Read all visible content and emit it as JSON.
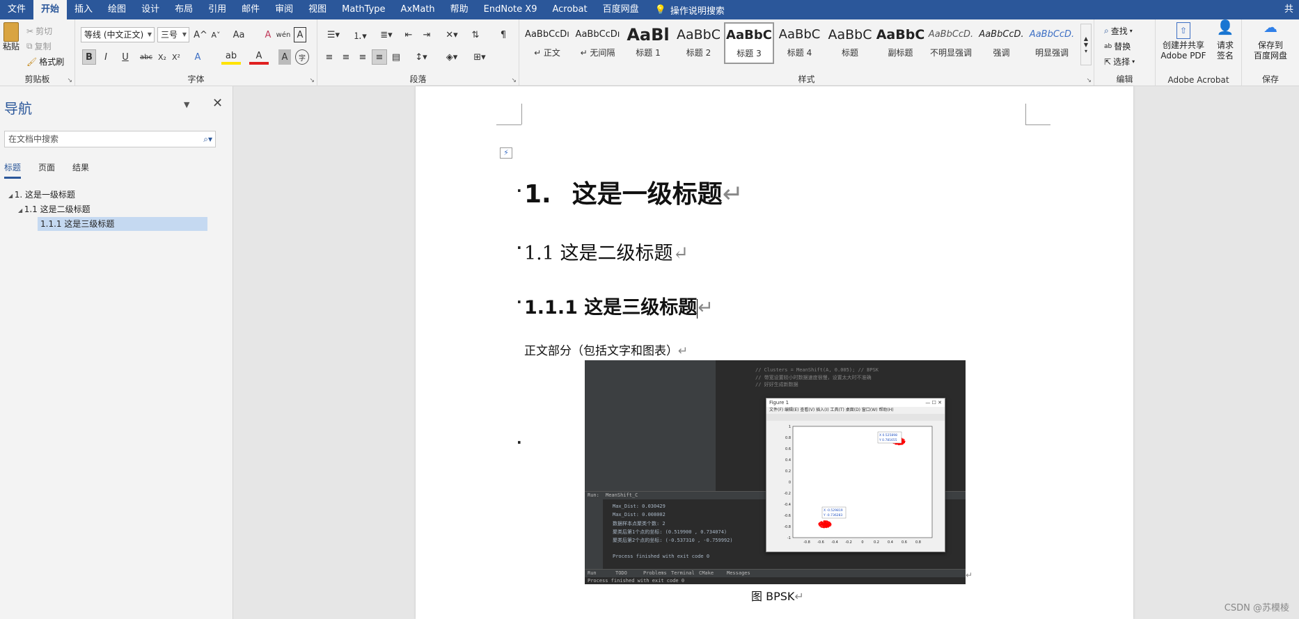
{
  "menu": {
    "tabs": [
      "文件",
      "开始",
      "插入",
      "绘图",
      "设计",
      "布局",
      "引用",
      "邮件",
      "审阅",
      "视图",
      "MathType",
      "AxMath",
      "帮助",
      "EndNote X9",
      "Acrobat",
      "百度网盘"
    ],
    "active": "开始",
    "search": "操作说明搜索",
    "user": "共"
  },
  "ribbon": {
    "clipboard": {
      "paste": "粘贴",
      "cut": "剪切",
      "copy": "复制",
      "format_painter": "格式刷",
      "label": "剪贴板"
    },
    "font": {
      "name": "等线 (中文正文)",
      "size": "三号",
      "label": "字体",
      "bold": "B",
      "italic": "I",
      "underline": "U",
      "strike": "abc",
      "sub": "X₂",
      "sup": "X²",
      "grow": "A^",
      "shrink": "A˅",
      "case": "Aa",
      "clear": "A",
      "phonetic": "wén",
      "border": "A",
      "effects": "A",
      "highlight": "ab",
      "color": "A",
      "shade": "A",
      "enclose": "字"
    },
    "paragraph": {
      "label": "段落"
    },
    "styles": {
      "label": "样式",
      "items": [
        {
          "sample": "AaBbCcDı",
          "name": "↵ 正文"
        },
        {
          "sample": "AaBbCcDı",
          "name": "↵ 无间隔"
        },
        {
          "sample": "AaBl",
          "name": "标题 1"
        },
        {
          "sample": "AaBbC",
          "name": "标题 2"
        },
        {
          "sample": "AaBbC",
          "name": "标题 3"
        },
        {
          "sample": "AaBbC",
          "name": "标题 4"
        },
        {
          "sample": "AaBbC",
          "name": "标题"
        },
        {
          "sample": "AaBbC",
          "name": "副标题"
        },
        {
          "sample": "AaBbCcD.",
          "name": "不明显强调"
        },
        {
          "sample": "AaBbCcD.",
          "name": "强调"
        },
        {
          "sample": "AaBbCcD.",
          "name": "明显强调"
        }
      ]
    },
    "editing": {
      "find": "查找",
      "replace": "替换",
      "select": "选择",
      "label": "编辑"
    },
    "acrobat": {
      "create": "创建并共享",
      "create2": "Adobe PDF",
      "sign": "请求",
      "sign2": "签名",
      "label": "Adobe Acrobat"
    },
    "save": {
      "btn": "保存到",
      "btn2": "百度网盘",
      "label": "保存"
    }
  },
  "nav": {
    "title": "导航",
    "search_placeholder": "在文档中搜索",
    "tabs": [
      "标题",
      "页面",
      "结果"
    ],
    "tree": [
      {
        "text": "1. 这是一级标题"
      },
      {
        "text": "1.1 这是二级标题"
      },
      {
        "text": "1.1.1 这是三级标题"
      }
    ]
  },
  "doc": {
    "h1_num": "1.",
    "h1_text": "这是一级标题",
    "h2": "1.1  这是二级标题",
    "h3": "1.1.1  这是三级标题",
    "body": "正文部分（包括文字和图表）",
    "caption": "图  BPSK"
  },
  "figure": {
    "code_lines": [
      "// Clusters = MeanShift(A, 0.005); // BPSK",
      "// 带宽设置较小时数据速度很慢，设置太大时不准确",
      "// 好好生成新数据"
    ],
    "fig_title": "Figure 1",
    "tip1_x": "X 0.525898",
    "tip1_y": "Y 0.781655",
    "tip2_x": "X -0.529819",
    "tip2_y": "Y -0.736283",
    "run_tab": "MeanShift_C",
    "console": [
      "Max_Dist: 0.030429",
      "Max_Dist: 0.008002",
      "数据样本点聚类个数: 2",
      "聚类后第1个点的坐标: (0.519900 , 0.734074)",
      "聚类后第2个点的坐标: (-0.537310 , -0.759992)",
      "",
      "Process finished with exit code 0"
    ],
    "bottom_tabs": [
      "Run",
      "TODO",
      "Problems",
      "Terminal",
      "CMake",
      "Messages"
    ],
    "status": "Process finished with exit code 0",
    "yticks": [
      "1",
      "0.8",
      "0.6",
      "0.4",
      "0.2",
      "0",
      "-0.2",
      "-0.4",
      "-0.6",
      "-0.8",
      "-1"
    ],
    "xticks": [
      "-0.8",
      "-0.6",
      "-0.4",
      "-0.2",
      "0",
      "0.2",
      "0.4",
      "0.6",
      "0.8"
    ]
  },
  "watermark": "CSDN @苏模棱"
}
